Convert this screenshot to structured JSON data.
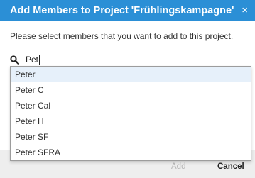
{
  "dialog": {
    "title": "Add Members to Project 'Frühlingskampagne'",
    "close_symbol": "×",
    "instructions": "Please select members that you want to add to this project."
  },
  "search": {
    "icon": "search-icon",
    "value": "Pet"
  },
  "suggestions": [
    {
      "label": "Peter",
      "selected": true
    },
    {
      "label": "Peter C",
      "selected": false
    },
    {
      "label": "Peter Cal",
      "selected": false
    },
    {
      "label": "Peter H",
      "selected": false
    },
    {
      "label": "Peter SF",
      "selected": false
    },
    {
      "label": "Peter SFRA",
      "selected": false
    }
  ],
  "footer": {
    "add_label": "Add",
    "cancel_label": "Cancel"
  },
  "colors": {
    "header": "#2b8fd6",
    "highlight": "#e6f0fa",
    "disabled_text": "#b7b7b7"
  }
}
